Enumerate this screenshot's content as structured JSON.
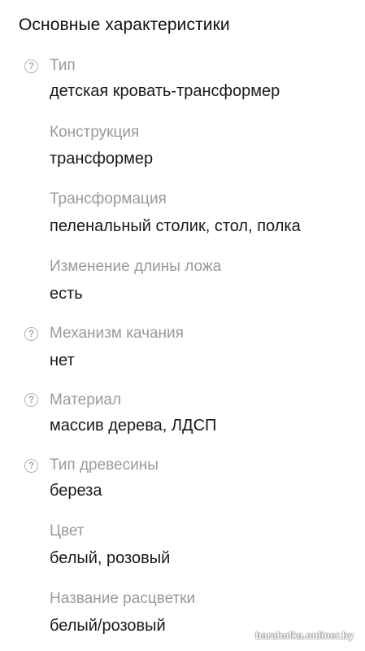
{
  "section": {
    "title": "Основные характеристики"
  },
  "specs": [
    {
      "label": "Тип",
      "value": "детская кровать-трансформер",
      "help": true
    },
    {
      "label": "Конструкция",
      "value": "трансформер",
      "help": false
    },
    {
      "label": "Трансформация",
      "value": "пеленальный столик, стол, полка",
      "help": false
    },
    {
      "label": "Изменение длины ложа",
      "value": "есть",
      "help": false
    },
    {
      "label": "Механизм качания",
      "value": "нет",
      "help": true
    },
    {
      "label": "Материал",
      "value": "массив дерева, ЛДСП",
      "help": true
    },
    {
      "label": "Тип древесины",
      "value": "береза",
      "help": true
    },
    {
      "label": "Цвет",
      "value": "белый, розовый",
      "help": false
    },
    {
      "label": "Название расцветки",
      "value": "белый/розовый",
      "help": false
    }
  ],
  "help_icon_glyph": "?",
  "watermark": "baraholka.onliner.by"
}
